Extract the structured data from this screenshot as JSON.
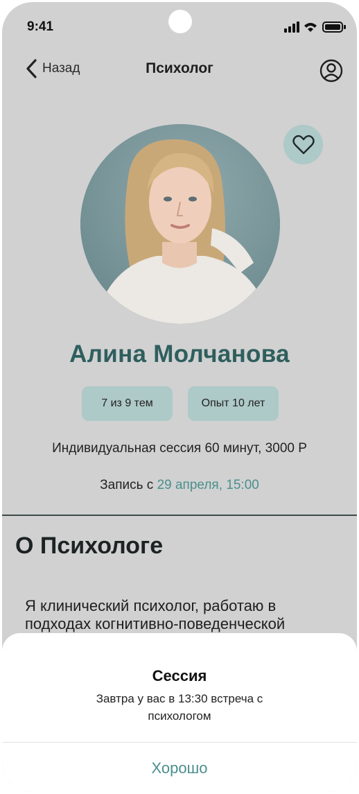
{
  "status_bar": {
    "time": "9:41"
  },
  "header": {
    "back_label": "Назад",
    "title": "Психолог"
  },
  "psychologist": {
    "name": "Алина Молчанова",
    "chips": [
      "7 из 9 тем",
      "Опыт 10 лет"
    ],
    "session_info": "Индивидуальная сессия 60 минут, 3000 Р",
    "booking_prefix": "Запись с",
    "booking_date": "29 апреля, 15:00"
  },
  "about": {
    "title": "О Психологе",
    "text": "Я клинический психолог, работаю в подходах когнитивно-поведенческой"
  },
  "alert": {
    "title": "Сессия",
    "message": "Завтра у вас в 13:30 встреча с психологом",
    "ok_label": "Хорошо"
  },
  "colors": {
    "accent": "#4a8f8d",
    "name": "#2f5e5e",
    "chip_bg": "#adc9c8",
    "screen_bg": "#d1d1d1"
  },
  "icons": {
    "back": "chevron-left-icon",
    "profile": "user-circle-icon",
    "favorite": "heart-icon"
  }
}
